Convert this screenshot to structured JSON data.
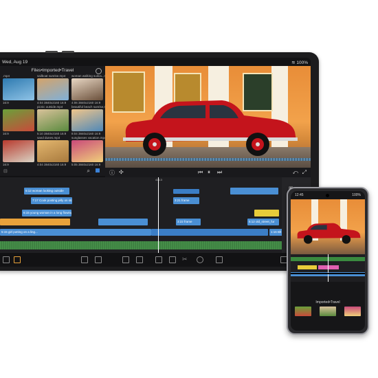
{
  "tablet": {
    "status": {
      "date": "Wed, Aug 19",
      "battery": "100%"
    },
    "media_panel": {
      "title": "Files•Imported•Travel",
      "items": [
        {
          "name": ".mp4",
          "meta": "16:9",
          "colors": [
            "#2e7ab0",
            "#8fc3e6"
          ]
        },
        {
          "name": "sailboat sunrise.mp4",
          "meta": "4:04 3840x2160 16:9",
          "colors": [
            "#d4a36a",
            "#7fb0d9"
          ]
        },
        {
          "name": "woman walking suitca...mp4",
          "meta": "4:06 3840x2160 16:9",
          "colors": [
            "#e8d7c4",
            "#6a4f3a"
          ]
        },
        {
          "name": "",
          "meta": "16:9",
          "colors": [
            "#6aa03a",
            "#c94a3a"
          ]
        },
        {
          "name": "picnic outside.mp4",
          "meta": "5:10 3840x2160 16:9",
          "colors": [
            "#d9c29a",
            "#5a8a3e"
          ]
        },
        {
          "name": "beautiful beach sunrise.mp4",
          "meta": "8:04 3840x2160 16:9",
          "colors": [
            "#f0c58a",
            "#4f88b8"
          ]
        },
        {
          "name": "",
          "meta": "16:9",
          "colors": [
            "#b83a2e",
            "#d9d3c4"
          ]
        },
        {
          "name": "sand dunes.mp4",
          "meta": "4:04 3840x2160 16:9",
          "colors": [
            "#e3b66e",
            "#a87a3e"
          ]
        },
        {
          "name": "sunglasses vacation.mp4",
          "meta": "5:05 3840x2160 16:9",
          "colors": [
            "#c94a7a",
            "#f0d07a"
          ]
        }
      ]
    },
    "timeline": {
      "timecode": "41:13",
      "clips": [
        {
          "label": "5:12 woman looking outside",
          "style": "bluec"
        },
        {
          "label": "7:17 Cook posting jelly on stove",
          "style": "bluec"
        },
        {
          "label": "6:15 young woman in a long flowing d...",
          "style": "bluec"
        },
        {
          "label": "3:21 frame",
          "style": "bluec"
        },
        {
          "label": "3:21 frame",
          "style": "blued"
        },
        {
          "label": "3:22 frame",
          "style": "blued"
        },
        {
          "label": "5:12 old_street_fur",
          "style": "bluec"
        },
        {
          "label": "1:16 Blt",
          "style": "bluec"
        },
        {
          "label": "5:15 girl putting on a ling...",
          "style": "bluec"
        }
      ]
    }
  },
  "phone": {
    "status": {
      "time": "12:45",
      "battery": "100%"
    },
    "media_title": "Imported•Travel"
  }
}
